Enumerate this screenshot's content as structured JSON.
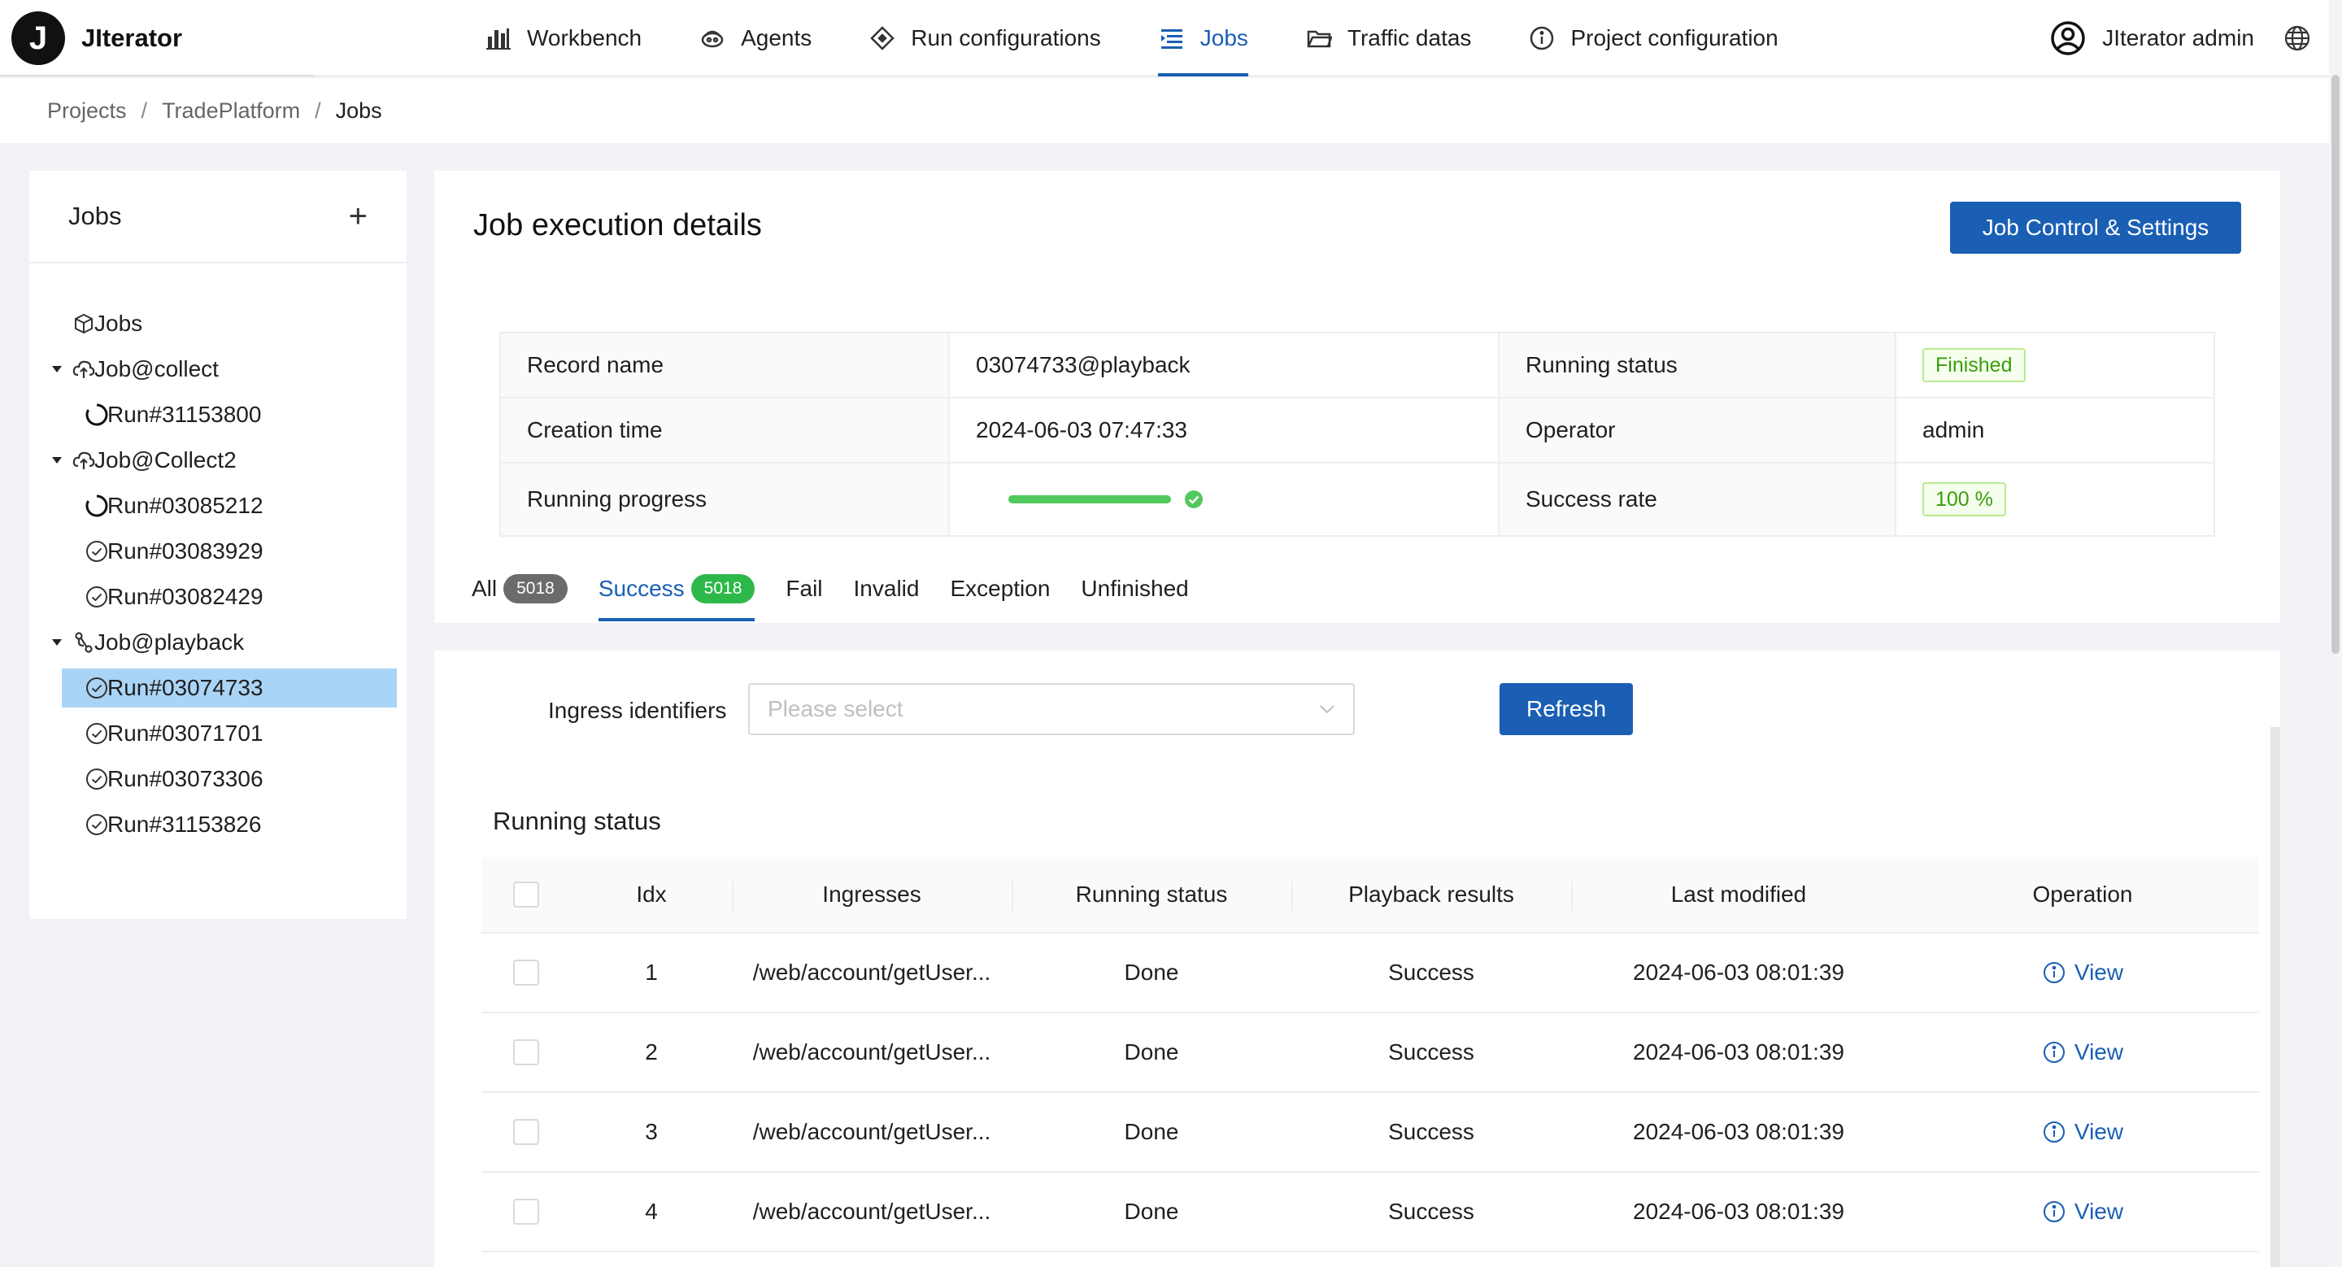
{
  "app": {
    "logo_letter": "J",
    "name": "JIterator"
  },
  "nav": {
    "items": [
      {
        "label": "Workbench",
        "icon": "bar-chart-icon"
      },
      {
        "label": "Agents",
        "icon": "agents-icon"
      },
      {
        "label": "Run configurations",
        "icon": "diamond-icon"
      },
      {
        "label": "Jobs",
        "icon": "list-icon",
        "active": true
      },
      {
        "label": "Traffic datas",
        "icon": "folder-icon"
      },
      {
        "label": "Project configuration",
        "icon": "info-icon"
      }
    ]
  },
  "user": {
    "name": "JIterator admin"
  },
  "breadcrumb": {
    "items": [
      "Projects",
      "TradePlatform",
      "Jobs"
    ]
  },
  "sidebar": {
    "title": "Jobs",
    "add_label": "+",
    "tree": [
      {
        "label": "Jobs",
        "level": 0,
        "icon": "cube-icon"
      },
      {
        "label": "Job@collect",
        "level": 0,
        "icon": "cloud-upload-icon",
        "expanded": true
      },
      {
        "label": "Run#31153800",
        "level": 1,
        "icon": "loading-icon"
      },
      {
        "label": "Job@Collect2",
        "level": 0,
        "icon": "cloud-upload-icon",
        "expanded": true
      },
      {
        "label": "Run#03085212",
        "level": 1,
        "icon": "loading-icon"
      },
      {
        "label": "Run#03083929",
        "level": 1,
        "icon": "check-circle-icon"
      },
      {
        "label": "Run#03082429",
        "level": 1,
        "icon": "check-circle-icon"
      },
      {
        "label": "Job@playback",
        "level": 0,
        "icon": "playback-icon",
        "expanded": true
      },
      {
        "label": "Run#03074733",
        "level": 1,
        "icon": "check-circle-icon",
        "selected": true
      },
      {
        "label": "Run#03071701",
        "level": 1,
        "icon": "check-circle-icon"
      },
      {
        "label": "Run#03073306",
        "level": 1,
        "icon": "check-circle-icon"
      },
      {
        "label": "Run#31153826",
        "level": 1,
        "icon": "check-circle-icon"
      }
    ]
  },
  "main": {
    "title": "Job execution details",
    "control_button": "Job Control & Settings",
    "details": {
      "record_name_label": "Record name",
      "record_name": "03074733@playback",
      "running_status_label": "Running status",
      "running_status": "Finished",
      "creation_time_label": "Creation time",
      "creation_time": "2024-06-03 07:47:33",
      "operator_label": "Operator",
      "operator": "admin",
      "progress_label": "Running progress",
      "progress_percent": 100,
      "success_rate_label": "Success rate",
      "success_rate": "100 %"
    },
    "tabs": [
      {
        "label": "All",
        "count": "5018"
      },
      {
        "label": "Success",
        "count": "5018",
        "active": true
      },
      {
        "label": "Fail"
      },
      {
        "label": "Invalid"
      },
      {
        "label": "Exception"
      },
      {
        "label": "Unfinished"
      }
    ]
  },
  "filter": {
    "label": "Ingress identifiers",
    "placeholder": "Please select",
    "refresh_label": "Refresh"
  },
  "table": {
    "section_title": "Running status",
    "columns": [
      "Idx",
      "Ingresses",
      "Running status",
      "Playback results",
      "Last modified",
      "Operation"
    ],
    "rows": [
      {
        "idx": "1",
        "ingress": "/web/account/getUser...",
        "status": "Done",
        "result": "Success",
        "modified": "2024-06-03 08:01:39",
        "op": "View"
      },
      {
        "idx": "2",
        "ingress": "/web/account/getUser...",
        "status": "Done",
        "result": "Success",
        "modified": "2024-06-03 08:01:39",
        "op": "View"
      },
      {
        "idx": "3",
        "ingress": "/web/account/getUser...",
        "status": "Done",
        "result": "Success",
        "modified": "2024-06-03 08:01:39",
        "op": "View"
      },
      {
        "idx": "4",
        "ingress": "/web/account/getUser...",
        "status": "Done",
        "result": "Success",
        "modified": "2024-06-03 08:01:39",
        "op": "View"
      }
    ]
  },
  "colors": {
    "primary": "#1a5fb4",
    "success": "#52c95e",
    "selected_bg": "#aad4f5"
  }
}
